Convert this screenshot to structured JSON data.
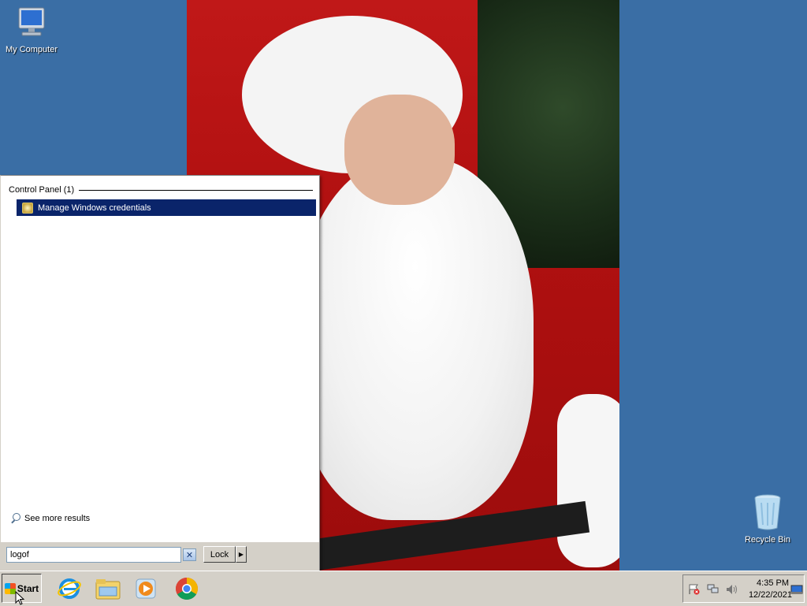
{
  "desktop": {
    "icons": [
      {
        "label": "My Computer",
        "icon": "computer-icon"
      },
      {
        "label": "Recycle Bin",
        "icon": "recycle-bin-icon"
      }
    ],
    "wallpaper": "santa-photo"
  },
  "start_menu": {
    "group_header": "Control Panel (1)",
    "results": [
      {
        "label": "Manage Windows credentials",
        "icon": "credential-manager-icon",
        "selected": true
      }
    ],
    "see_more_label": "See more results",
    "search": {
      "value": "logof"
    },
    "lock_label": "Lock"
  },
  "taskbar": {
    "start_label": "Start",
    "pinned": [
      "internet-explorer-icon",
      "file-explorer-icon",
      "media-player-icon",
      "chrome-icon"
    ],
    "tray_icons": [
      "action-center-flag-icon",
      "network-icon",
      "volume-icon",
      "show-desktop-icon"
    ],
    "clock": {
      "time": "4:35 PM",
      "date": "12/22/2021"
    }
  },
  "colors": {
    "desktop": "#3a6ea5",
    "selection": "#0a246a",
    "chrome": "#d4d0c8"
  }
}
